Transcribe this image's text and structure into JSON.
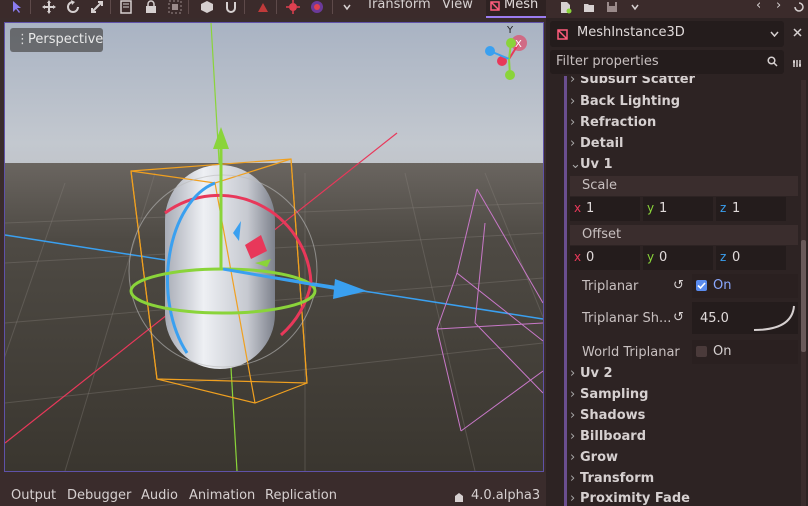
{
  "toolbar": {
    "menu_transform": "Transform",
    "menu_view": "View",
    "tab_mesh": "Mesh"
  },
  "viewport": {
    "perspective_label": "Perspective",
    "gizmo_labels": {
      "x": "X",
      "y": "Y"
    }
  },
  "bottom_panel": {
    "tabs": [
      "Output",
      "Debugger",
      "Audio",
      "Animation",
      "Replication"
    ],
    "version": "4.0.alpha3"
  },
  "inspector": {
    "node_name": "MeshInstance3D",
    "filter_placeholder": "Filter properties",
    "sections_top": [
      "Subsurf Scatter",
      "Back Lighting",
      "Refraction",
      "Detail"
    ],
    "uv1": {
      "title": "Uv 1",
      "scale_label": "Scale",
      "scale": {
        "x": "1",
        "y": "1",
        "z": "1"
      },
      "offset_label": "Offset",
      "offset": {
        "x": "0",
        "y": "0",
        "z": "0"
      },
      "triplanar_label": "Triplanar",
      "triplanar_value": "On",
      "triplanar_sharpness_label": "Triplanar Sh...",
      "triplanar_sharpness_value": "45.0",
      "world_triplanar_label": "World Triplanar",
      "world_triplanar_value": "On"
    },
    "sections_bottom": [
      "Uv 2",
      "Sampling",
      "Shadows",
      "Billboard",
      "Grow",
      "Transform",
      "Proximity Fade"
    ]
  },
  "colors": {
    "accent": "#9b7cf0",
    "x_axis": "#e8385a",
    "y_axis": "#8ad43a",
    "z_axis": "#3aa0f0"
  }
}
